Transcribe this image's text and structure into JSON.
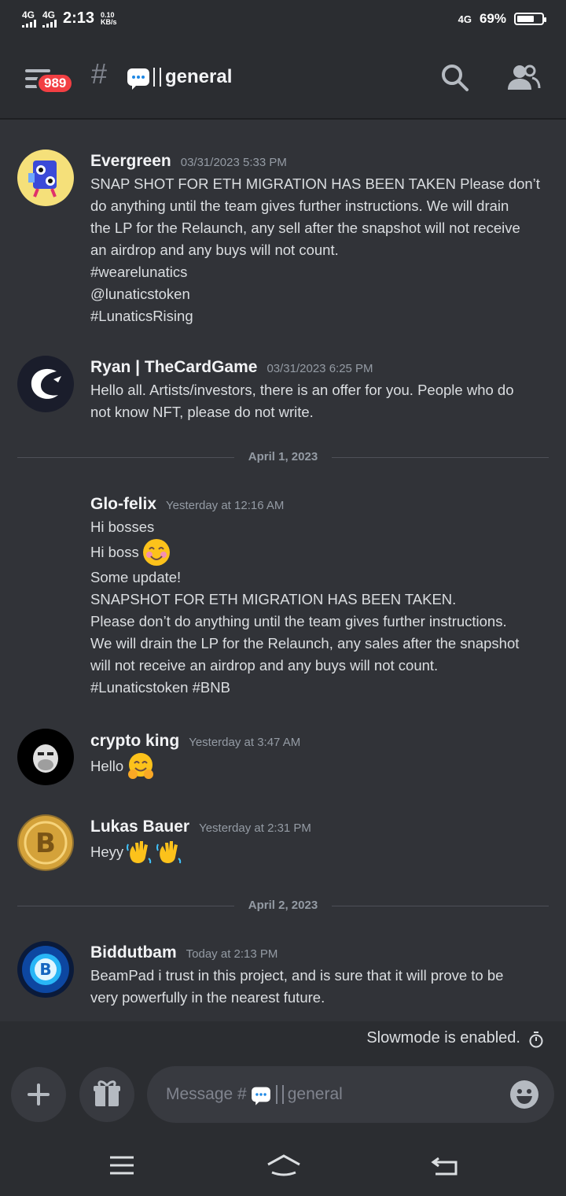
{
  "status_bar": {
    "network1": "4G",
    "network2": "4G",
    "time": "2:13",
    "speed_value": "0.10",
    "speed_unit": "KB/s",
    "network3": "4G",
    "battery": "69%",
    "battery_level": 0.69
  },
  "header": {
    "unread_badge": "989",
    "channel_hash": "#",
    "channel_name": "general"
  },
  "messages": [
    {
      "author": "Evergreen",
      "time": "03/31/2023 5:33 PM",
      "lines": [
        "SNAP SHOT FOR ETH MIGRATION HAS BEEN TAKEN Please don’t",
        "do anything until the team gives further instructions. We will drain",
        "the LP for the Relaunch, any sell after the snapshot will not receive",
        "an airdrop and any buys will not count.",
        "#wearelunatics",
        "@lunaticstoken",
        "#LunaticsRising"
      ]
    },
    {
      "author": "Ryan | TheCardGame",
      "time": "03/31/2023 6:25 PM",
      "lines": [
        "Hello all. Artists/investors, there is an offer for you. People who do",
        "not know NFT, please do not write."
      ]
    },
    {
      "author": "Glo-felix",
      "time": "Yesterday at 12:16 AM",
      "lines": [
        "Hi bosses",
        "Hi boss",
        "Some update!",
        "SNAPSHOT FOR ETH MIGRATION HAS BEEN TAKEN.",
        "Please don’t do anything until the team gives further instructions.",
        "We will drain the LP for the Relaunch, any sales after the snapshot",
        "will not receive an airdrop and any buys will not count.",
        "#Lunaticstoken #BNB"
      ]
    },
    {
      "author": "crypto king",
      "time": "Yesterday at 3:47 AM",
      "lines": [
        "Hello"
      ]
    },
    {
      "author": "Lukas Bauer",
      "time": "Yesterday at 2:31 PM",
      "lines": [
        "Heyy"
      ]
    },
    {
      "author": "Biddutbam",
      "time": "Today at 2:13 PM",
      "lines": [
        "BeamPad i trust in this project, and is sure that it will prove to be",
        "very powerfully in the nearest future."
      ]
    }
  ],
  "dividers": [
    "April 1, 2023",
    "April 2, 2023"
  ],
  "slowmode_text": "Slowmode is enabled.",
  "composer": {
    "placeholder_prefix": "Message #",
    "placeholder_channel": "general"
  },
  "icons": {
    "menu": "hamburger-icon",
    "search": "search-icon",
    "members": "members-icon",
    "add": "plus-icon",
    "gift": "gift-icon",
    "emoji": "emoji-icon",
    "timer": "timer-icon",
    "nav_menu": "nav-menu-icon",
    "nav_home": "nav-home-icon",
    "nav_back": "nav-back-icon"
  },
  "colors": {
    "background": "#313338",
    "header": "#2b2d31",
    "badge": "#f23f43",
    "text": "#dbdee1",
    "muted": "#949ba4"
  }
}
